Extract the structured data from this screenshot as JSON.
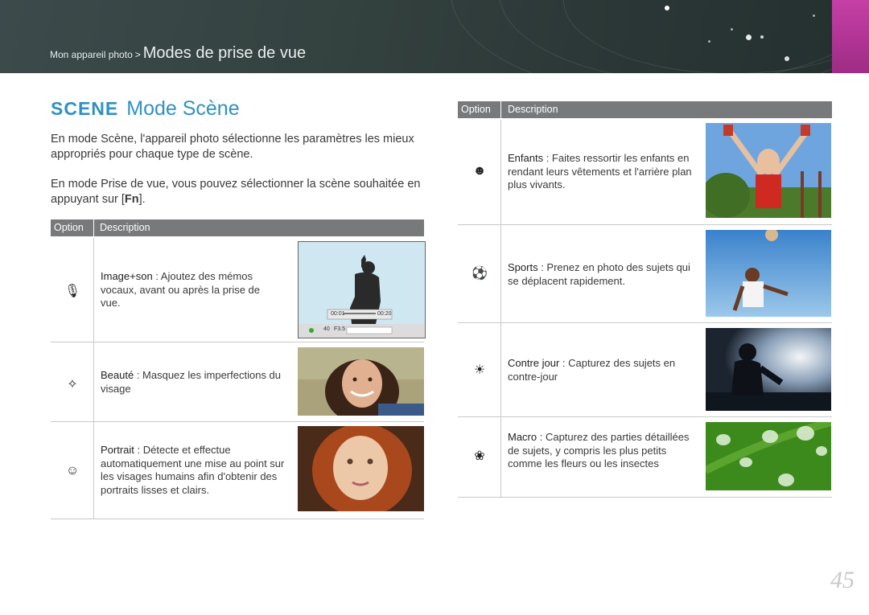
{
  "header": {
    "breadcrumb_small": "Mon appareil photo",
    "breadcrumb_sep": ">",
    "breadcrumb_big": "Modes de prise de vue"
  },
  "section": {
    "scene_label": "SCENE",
    "title": "Mode Scène",
    "para1": "En mode Scène, l'appareil photo sélectionne les paramètres les mieux appropriés pour chaque type de scène.",
    "para2_before": "En mode Prise de vue, vous pouvez sélectionner la scène souhaitée en appuyant sur [",
    "para2_key": "Fn",
    "para2_after": "]."
  },
  "table_headers": {
    "option": "Option",
    "description": "Description"
  },
  "left_rows": [
    {
      "icon": "image-sound-icon",
      "glyph": "🎙",
      "name": "Image+son",
      "text": " : Ajoutez des mémos vocaux, avant ou après la prise de vue."
    },
    {
      "icon": "beauty-icon",
      "glyph": "✧",
      "name": "Beauté",
      "text": " : Masquez les imperfections du visage"
    },
    {
      "icon": "portrait-icon",
      "glyph": "☺",
      "name": "Portrait",
      "text": " : Détecte et effectue automatiquement une mise au point sur les visages humains afin d'obtenir des portraits lisses et clairs."
    }
  ],
  "right_rows": [
    {
      "icon": "children-icon",
      "glyph": "☻",
      "name": "Enfants",
      "text": " : Faites ressortir les enfants en rendant leurs vêtements et l'arrière plan plus vivants."
    },
    {
      "icon": "sports-icon",
      "glyph": "⚽",
      "name": "Sports",
      "text": " : Prenez en photo des sujets qui se déplacent rapidement."
    },
    {
      "icon": "backlight-icon",
      "glyph": "☀",
      "name": "Contre jour",
      "text": " : Capturez des sujets en contre-jour"
    },
    {
      "icon": "macro-icon",
      "glyph": "❀",
      "name": "Macro",
      "text": " : Capturez des parties détaillées de sujets, y compris les plus petits comme les fleurs ou les insectes"
    }
  ],
  "screen_readout": {
    "time_start": "00:01",
    "time_end": "00:20",
    "aperture": "F3.5",
    "shutter": "40"
  },
  "page_number": "45",
  "colors": {
    "accent": "#2f91c4",
    "header_bg": "#33413f",
    "tab_pink": "#b53698",
    "table_header": "#77797a"
  }
}
